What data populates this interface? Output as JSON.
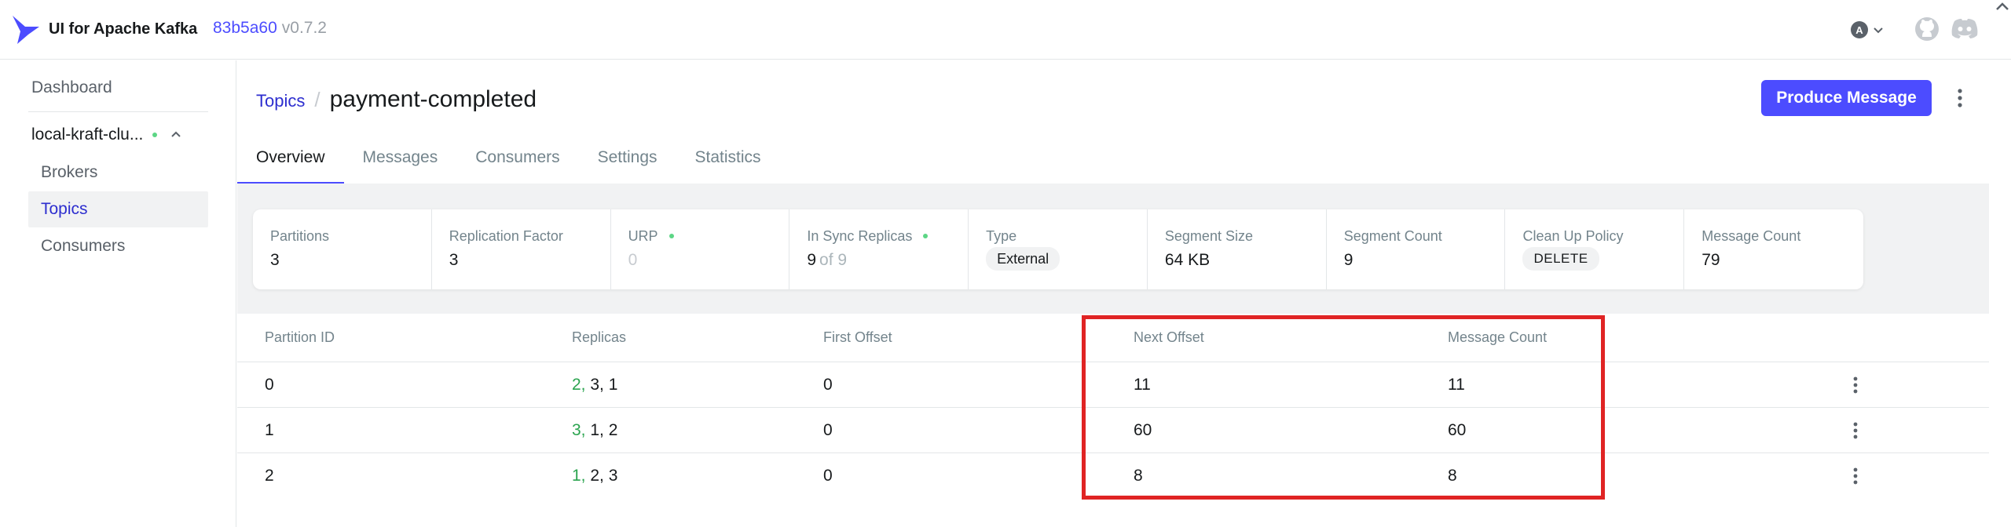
{
  "app": {
    "title": "UI for Apache Kafka",
    "commit": "83b5a60",
    "version": "v0.7.2",
    "user_initial": "A"
  },
  "sidebar": {
    "dashboard": "Dashboard",
    "cluster": {
      "name": "local-kraft-clu...",
      "status_color": "#5cd685"
    },
    "items": [
      {
        "label": "Brokers",
        "active": false
      },
      {
        "label": "Topics",
        "active": true
      },
      {
        "label": "Consumers",
        "active": false
      }
    ]
  },
  "header": {
    "breadcrumb_link": "Topics",
    "separator": "/",
    "title": "payment-completed",
    "produce_button": "Produce Message"
  },
  "tabs": [
    {
      "label": "Overview",
      "active": true
    },
    {
      "label": "Messages",
      "active": false
    },
    {
      "label": "Consumers",
      "active": false
    },
    {
      "label": "Settings",
      "active": false
    },
    {
      "label": "Statistics",
      "active": false
    }
  ],
  "stats": {
    "partitions": {
      "label": "Partitions",
      "value": "3"
    },
    "replication_factor": {
      "label": "Replication Factor",
      "value": "3"
    },
    "urp": {
      "label": "URP",
      "value": "0"
    },
    "in_sync_replicas": {
      "label": "In Sync Replicas",
      "value": "9",
      "of": "of 9"
    },
    "type": {
      "label": "Type",
      "value": "External"
    },
    "segment_size": {
      "label": "Segment Size",
      "value": "64 KB"
    },
    "segment_count": {
      "label": "Segment Count",
      "value": "9"
    },
    "clean_up_policy": {
      "label": "Clean Up Policy",
      "value": "DELETE"
    },
    "message_count": {
      "label": "Message Count",
      "value": "79"
    }
  },
  "table": {
    "headers": {
      "partition_id": "Partition ID",
      "replicas": "Replicas",
      "first_offset": "First Offset",
      "next_offset": "Next Offset",
      "message_count": "Message Count"
    },
    "rows": [
      {
        "partition_id": "0",
        "leader": "2,",
        "replicas_rest": " 3, 1",
        "first_offset": "0",
        "next_offset": "11",
        "message_count": "11"
      },
      {
        "partition_id": "1",
        "leader": "3,",
        "replicas_rest": " 1, 2",
        "first_offset": "0",
        "next_offset": "60",
        "message_count": "60"
      },
      {
        "partition_id": "2",
        "leader": "1,",
        "replicas_rest": " 2, 3",
        "first_offset": "0",
        "next_offset": "8",
        "message_count": "8"
      }
    ]
  },
  "colors": {
    "accent": "#4c4cff",
    "link": "#2d2ecf",
    "leader": "#2ba44f",
    "highlight": "#e02424"
  }
}
